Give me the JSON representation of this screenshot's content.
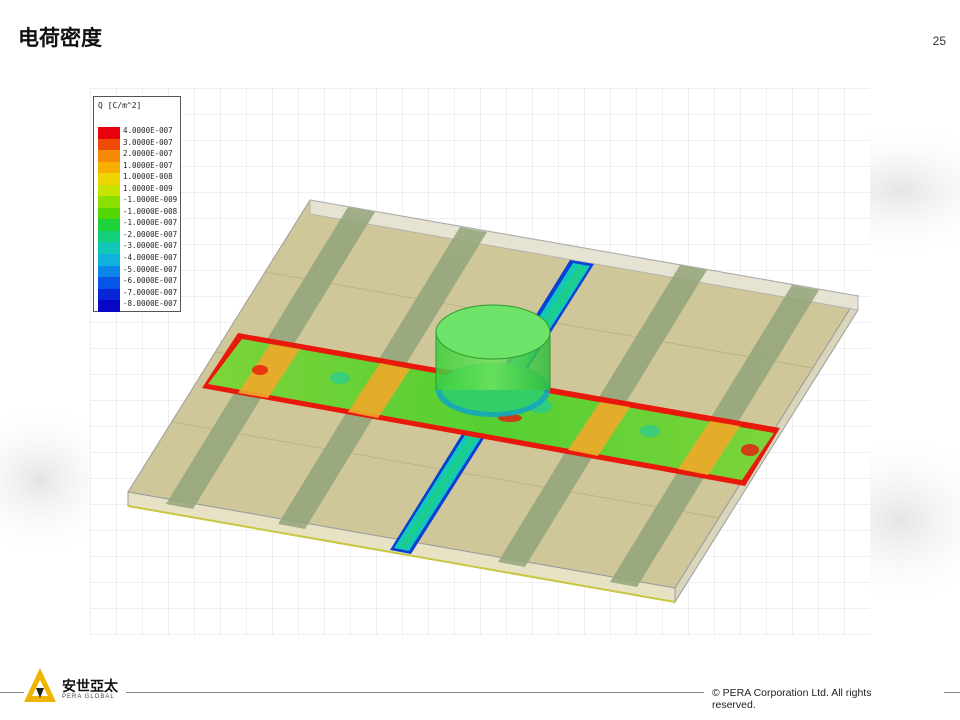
{
  "slide": {
    "title": "电荷密度",
    "page_number": "25"
  },
  "legend": {
    "title": "Q [C/m^2]",
    "entries": [
      {
        "label": "4.0000E-007",
        "color": "#e8000c"
      },
      {
        "label": "3.0000E-007",
        "color": "#f04a08"
      },
      {
        "label": "2.0000E-007",
        "color": "#f58a05"
      },
      {
        "label": "1.0000E-007",
        "color": "#f7b000"
      },
      {
        "label": "1.0000E-008",
        "color": "#eed400"
      },
      {
        "label": "1.0000E-009",
        "color": "#c6e400"
      },
      {
        "label": "-1.0000E-009",
        "color": "#8ce000"
      },
      {
        "label": "-1.0000E-008",
        "color": "#52d800"
      },
      {
        "label": "-1.0000E-007",
        "color": "#1ed23a"
      },
      {
        "label": "-2.0000E-007",
        "color": "#12cf7c"
      },
      {
        "label": "-3.0000E-007",
        "color": "#10c8b6"
      },
      {
        "label": "-4.0000E-007",
        "color": "#0eb2dc"
      },
      {
        "label": "-5.0000E-007",
        "color": "#0a86e6"
      },
      {
        "label": "-6.0000E-007",
        "color": "#0655e6"
      },
      {
        "label": "-7.0000E-007",
        "color": "#0826d8"
      },
      {
        "label": "-8.0000E-007",
        "color": "#0a06c8"
      }
    ]
  },
  "footer": {
    "logo_text": "安世亞太",
    "logo_subtext": "PERA GLOBAL",
    "copyright": "©  PERA Corporation Ltd. All rights reserved."
  },
  "colors": {
    "board": "#cfc79a",
    "board_edge": "#b7b086",
    "stripe": "#93a57a",
    "grid": "#dcdcdc"
  }
}
